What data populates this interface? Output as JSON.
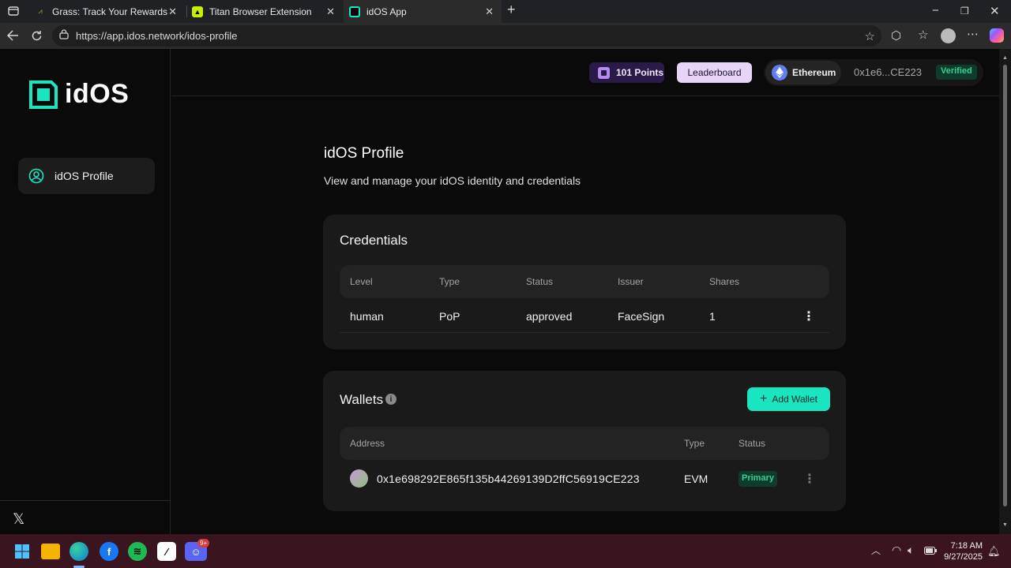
{
  "browser": {
    "tabs": [
      {
        "title": "Grass: Track Your Rewards"
      },
      {
        "title": "Titan Browser Extension"
      },
      {
        "title": "idOS App"
      }
    ],
    "url": "https://app.idos.network/idos-profile"
  },
  "app": {
    "logo_text": "idOS",
    "sidebar": {
      "items": [
        {
          "label": "idOS Profile",
          "icon": "user-circle-icon"
        }
      ]
    },
    "header": {
      "points": "101 Points",
      "leaderboard": "Leaderboard",
      "network": "Ethereum",
      "address": "0x1e6...CE223",
      "verified": "Verified"
    },
    "page": {
      "title": "idOS Profile",
      "subtitle": "View and manage your idOS identity and credentials"
    },
    "credentials": {
      "title": "Credentials",
      "columns": [
        "Level",
        "Type",
        "Status",
        "Issuer",
        "Shares"
      ],
      "rows": [
        {
          "level": "human",
          "type": "PoP",
          "status": "approved",
          "issuer": "FaceSign",
          "shares": "1"
        }
      ]
    },
    "wallets": {
      "title": "Wallets",
      "add_button": "Add Wallet",
      "columns": [
        "Address",
        "Type",
        "Status"
      ],
      "rows": [
        {
          "address": "0x1e698292E865f135b44269139D2ffC56919CE223",
          "type": "EVM",
          "status": "Primary"
        }
      ]
    }
  },
  "taskbar": {
    "time": "7:18 AM",
    "date": "9/27/2025",
    "discord_badge": "9+"
  },
  "colors": {
    "accent": "#19e6c1",
    "leaderboard_bg": "#e6d5f7",
    "points_bg": "#2a1a4a",
    "verified_bg": "#0f3b2c",
    "verified_text": "#2fd48d"
  }
}
